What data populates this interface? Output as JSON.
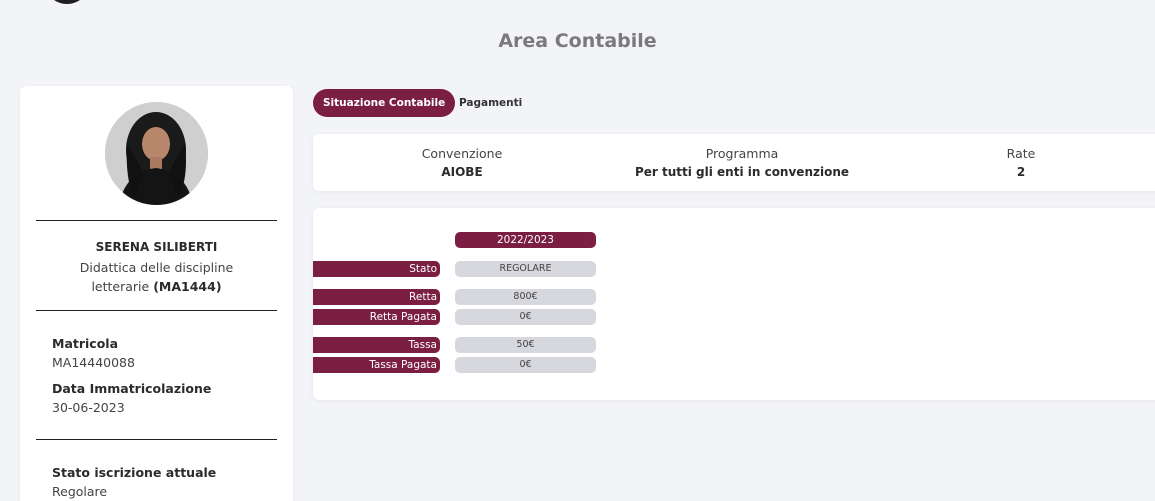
{
  "page_title": "Area Contabile",
  "profile": {
    "name": "SERENA SILIBERTI",
    "course": "Didattica delle discipline letterarie",
    "course_code": "(MA1444)",
    "fields": [
      {
        "label": "Matricola",
        "value": "MA14440088"
      },
      {
        "label": "Data Immatricolazione",
        "value": "30-06-2023"
      },
      {
        "label": "Stato iscrizione attuale",
        "value": "Regolare"
      }
    ]
  },
  "tabs": [
    {
      "label": "Situazione Contabile",
      "active": true
    },
    {
      "label": "Pagamenti",
      "active": false
    }
  ],
  "summary": [
    {
      "label": "Convenzione",
      "value": "AIOBE"
    },
    {
      "label": "Programma",
      "value": "Per tutti gli enti in convenzione"
    },
    {
      "label": "Rate",
      "value": "2"
    }
  ],
  "detail": {
    "year": "2022/2023",
    "rows": [
      {
        "label": "Stato",
        "value": "REGOLARE"
      },
      {
        "label": "Retta",
        "value": "800€"
      },
      {
        "label": "Retta Pagata",
        "value": "0€"
      },
      {
        "label": "Tassa",
        "value": "50€"
      },
      {
        "label": "Tassa Pagata",
        "value": "0€"
      }
    ]
  },
  "colors": {
    "accent": "#7a1e42",
    "value_pill": "#d7d8dd",
    "background": "#f3f4f7"
  }
}
